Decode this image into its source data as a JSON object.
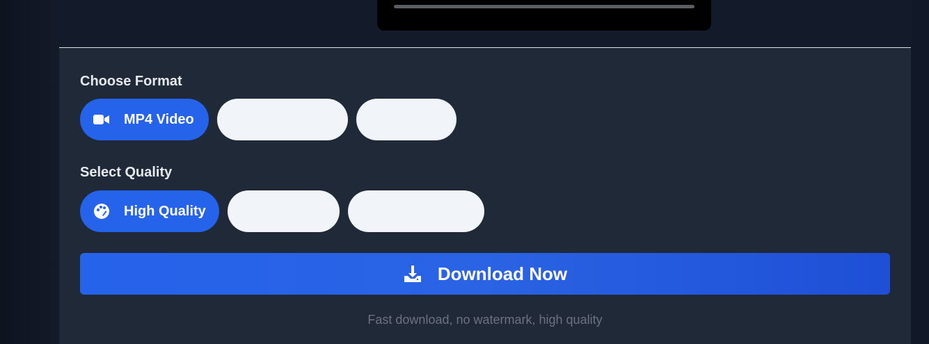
{
  "format_section": {
    "label": "Choose Format",
    "options": [
      {
        "label": "MP4 Video",
        "icon": "video-camera-icon",
        "selected": true
      },
      {
        "label": "",
        "selected": false
      },
      {
        "label": "",
        "selected": false
      }
    ]
  },
  "quality_section": {
    "label": "Select Quality",
    "options": [
      {
        "label": "High Quality",
        "icon": "palette-icon",
        "selected": true
      },
      {
        "label": "",
        "selected": false
      },
      {
        "label": "",
        "selected": false
      }
    ]
  },
  "download_button": {
    "label": "Download Now",
    "icon": "download-icon"
  },
  "footnote": "Fast download, no watermark, high quality",
  "colors": {
    "accent": "#2563eb",
    "panel_bg": "#202938",
    "page_bg": "#111827",
    "inactive_pill": "#f1f4f8",
    "muted_text": "#6b7280"
  }
}
